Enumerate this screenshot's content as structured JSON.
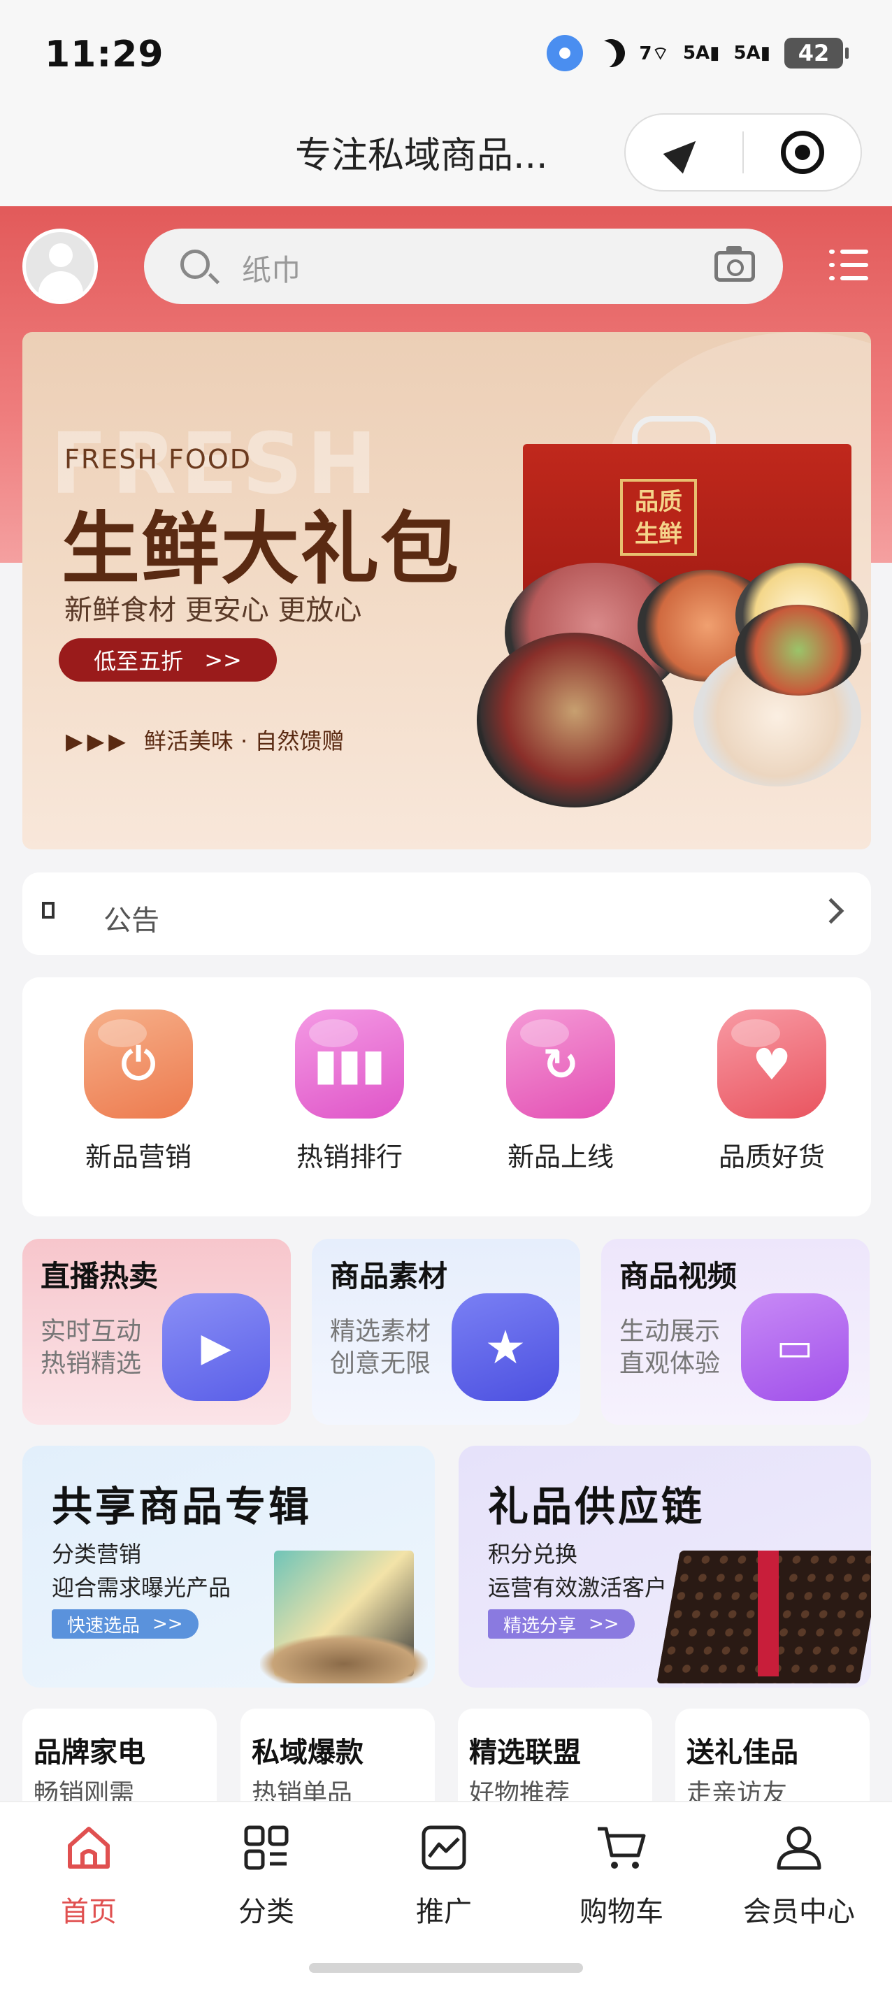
{
  "status": {
    "time": "11:29",
    "signal1": "7",
    "signal2": "5A",
    "signal3": "5A",
    "battery": "42"
  },
  "nav": {
    "title": "专注私域商品..."
  },
  "search": {
    "placeholder": "纸巾"
  },
  "banner": {
    "bg_word": "FRESH",
    "en": "FRESH FOOD",
    "title": "生鲜大礼包",
    "subtitle": "新鲜食材 更安心 更放心",
    "pill": "低至五折",
    "pill_arrow": ">>",
    "tag": "鲜活美味 · 自然馈赠",
    "tag_arrows": "▶▶▶"
  },
  "notice": {
    "label": "公告"
  },
  "grid": [
    {
      "label": "新品营销",
      "icon": "power-icon",
      "color": "#f08a5c"
    },
    {
      "label": "热销排行",
      "icon": "bar-chart-icon",
      "color": "#e86ad0"
    },
    {
      "label": "新品上线",
      "icon": "refresh-icon",
      "color": "#ea62c0"
    },
    {
      "label": "品质好货",
      "icon": "heart-icon",
      "color": "#f0677a"
    }
  ],
  "features": [
    {
      "title": "直播热卖",
      "sub1": "实时互动",
      "sub2": "热销精选",
      "icon": "video-camera-icon",
      "color": "#6a6ff0"
    },
    {
      "title": "商品素材",
      "sub1": "精选素材",
      "sub2": "创意无限",
      "icon": "star-icon",
      "color": "#5a62ea"
    },
    {
      "title": "商品视频",
      "sub1": "生动展示",
      "sub2": "直观体验",
      "icon": "monitor-icon",
      "color": "#b060f0"
    }
  ],
  "promos": [
    {
      "title": "共享商品专辑",
      "line1": "分类营销",
      "line2": "迎合需求曝光产品",
      "button": "快速选品",
      "arrow": ">>"
    },
    {
      "title": "礼品供应链",
      "line1": "积分兑换",
      "line2": "运营有效激活客户",
      "button": "精选分享",
      "arrow": ">>"
    }
  ],
  "categories": [
    {
      "title": "品牌家电",
      "sub": "畅销刚需"
    },
    {
      "title": "私域爆款",
      "sub": "热销单品"
    },
    {
      "title": "精选联盟",
      "sub": "好物推荐"
    },
    {
      "title": "送礼佳品",
      "sub": "走亲访友"
    }
  ],
  "tabs": [
    {
      "label": "首页",
      "icon": "home-icon",
      "active": true
    },
    {
      "label": "分类",
      "icon": "category-grid-icon"
    },
    {
      "label": "推广",
      "icon": "promotion-chart-icon"
    },
    {
      "label": "购物车",
      "icon": "cart-icon"
    },
    {
      "label": "会员中心",
      "icon": "user-icon"
    }
  ],
  "colors": {
    "accent": "#e05050",
    "header": "#e25a5a"
  }
}
